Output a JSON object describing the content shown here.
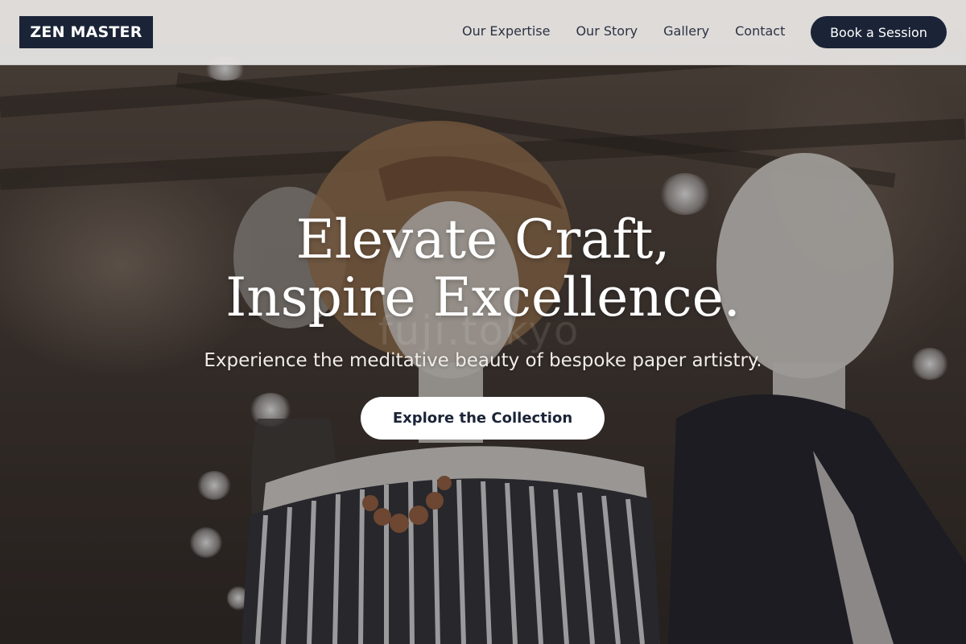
{
  "header": {
    "logo_text": "ZEN MASTER",
    "nav": [
      {
        "label": "Our Expertise"
      },
      {
        "label": "Our Story"
      },
      {
        "label": "Gallery"
      },
      {
        "label": "Contact"
      }
    ],
    "cta_label": "Book a Session"
  },
  "hero": {
    "headline_line1": "Elevate Craft,",
    "headline_line2": "Inspire Excellence.",
    "subtitle": "Experience the meditative beauty of bespoke paper artistry.",
    "cta_label": "Explore the Collection",
    "background_watermark": "fuji.tokyo"
  },
  "colors": {
    "brand_navy": "#1b2437",
    "header_bg": "#e4e2e0",
    "white": "#ffffff"
  }
}
